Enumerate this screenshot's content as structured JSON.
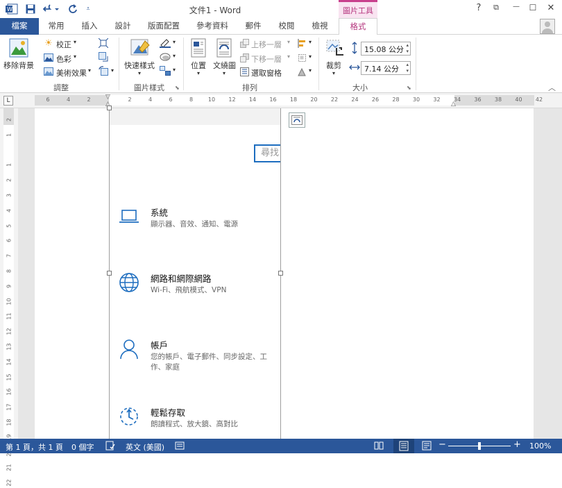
{
  "title_bar": {
    "title": "文件1 - Word",
    "context_group": "圖片工具",
    "help": "?",
    "ribbon_display": "⧉",
    "minimize": "—",
    "maximize": "☐",
    "close": "✕"
  },
  "tabs": [
    {
      "label": "檔案"
    },
    {
      "label": "常用"
    },
    {
      "label": "插入"
    },
    {
      "label": "設計"
    },
    {
      "label": "版面配置"
    },
    {
      "label": "參考資料"
    },
    {
      "label": "郵件"
    },
    {
      "label": "校閱"
    },
    {
      "label": "檢視"
    },
    {
      "label": "格式"
    }
  ],
  "ribbon": {
    "adjust": {
      "remove_bg": "移除背景",
      "corrections": "校正",
      "color": "色彩",
      "artistic": "美術效果",
      "group_label": "調整"
    },
    "styles": {
      "quick_styles": "快速樣式",
      "group_label": "圖片樣式"
    },
    "arrange": {
      "position": "位置",
      "wrap_text": "文繞圖",
      "bring_forward": "上移一層",
      "send_backward": "下移一層",
      "selection_pane": "選取窗格",
      "group_label": "排列"
    },
    "size": {
      "crop": "裁剪",
      "height": "15.08 公分",
      "width": "7.14 公分",
      "group_label": "大小"
    },
    "collapse": "︿"
  },
  "ruler": {
    "h_numbers": [
      "6",
      "4",
      "2",
      "",
      "2",
      "4",
      "6",
      "8",
      "10",
      "12",
      "14",
      "16",
      "18",
      "20",
      "22",
      "24",
      "26",
      "28",
      "30",
      "32",
      "34",
      "36",
      "38",
      "40",
      "42"
    ],
    "v_numbers": [
      "2",
      "1",
      "",
      "1",
      "2",
      "3",
      "4",
      "5",
      "6",
      "7",
      "8",
      "9",
      "10",
      "11",
      "12",
      "13",
      "14",
      "15",
      "16",
      "17",
      "18",
      "19",
      "20",
      "21",
      "22"
    ],
    "corner": "L"
  },
  "picture": {
    "search_placeholder": "尋找",
    "settings": [
      {
        "icon": "laptop-icon",
        "title": "系統",
        "desc": "顯示器、音效、通知、電源"
      },
      {
        "icon": "globe-icon",
        "title": "網路和網際網路",
        "desc": "Wi-Fi、飛航模式、VPN"
      },
      {
        "icon": "person-icon",
        "title": "帳戶",
        "desc": "您的帳戶、電子郵件、同步設定、工作、家庭"
      },
      {
        "icon": "ease-of-access-icon",
        "title": "輕鬆存取",
        "desc": "朗讀程式、放大鏡、高對比"
      }
    ]
  },
  "status": {
    "page": "第 1 頁，共 1 頁",
    "words": "0 個字",
    "language": "英文 (美國)",
    "zoom": "100%",
    "zoom_level": 1.0
  },
  "colors": {
    "word_blue": "#2b579a",
    "context_pink": "#b5367e",
    "settings_icon": "#1d6dbf"
  }
}
